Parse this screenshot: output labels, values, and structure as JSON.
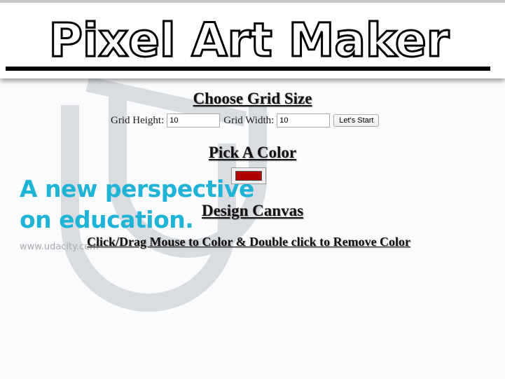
{
  "header": {
    "title": "Pixel Art Maker"
  },
  "grid_size": {
    "heading": "Choose Grid Size",
    "height_label": "Grid Height:",
    "height_value": "10",
    "width_label": "Grid Width:",
    "width_value": "10",
    "start_button": "Let's Start"
  },
  "color": {
    "heading": "Pick A Color",
    "selected": "#b00000"
  },
  "canvas": {
    "heading": "Design Canvas",
    "instructions": "Click/Drag Mouse to Color & Double click to Remove Color"
  },
  "background": {
    "tagline_line1": "A new perspective",
    "tagline_line2": "on education.",
    "url": "www.udacity.com",
    "logo_icon": "udacity-logo-icon",
    "logo_color": "#d9dde2",
    "tagline_color": "#1fb3d6"
  }
}
